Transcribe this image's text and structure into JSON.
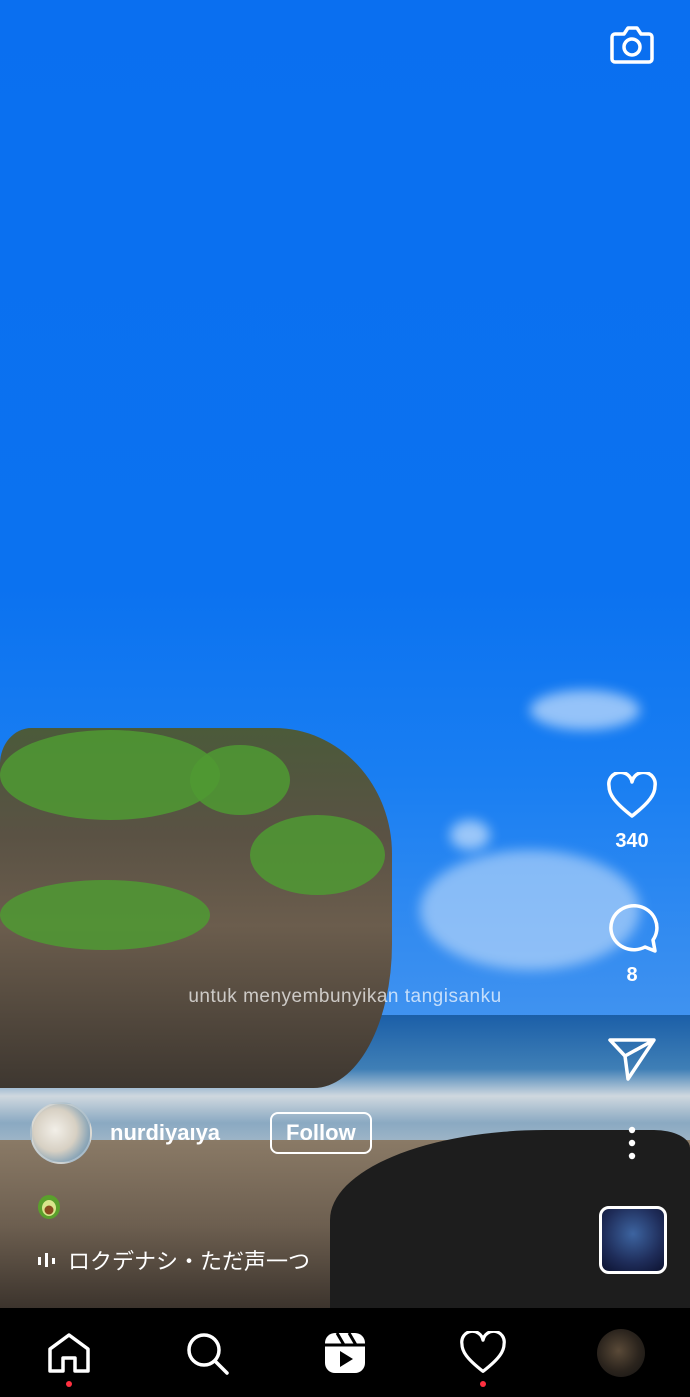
{
  "reel": {
    "caption_overlay": "untuk menyembunyikan tangisanku",
    "author": {
      "username": "nurdiyaıya",
      "follow_label": "Follow"
    },
    "audio": {
      "title": "ロクデナシ・ただ声一つ"
    }
  },
  "actions": {
    "likes": "340",
    "comments": "8"
  },
  "nav": {
    "home_has_notification": true,
    "activity_has_notification": true
  },
  "colors": {
    "sky": "#0b72f0",
    "notification_dot": "#ff3040",
    "nav_bg": "#000000"
  },
  "icons": [
    "camera-icon",
    "heart-icon",
    "comment-icon",
    "share-icon",
    "more-icon",
    "audio-wave-icon",
    "home-icon",
    "search-icon",
    "reels-icon",
    "activity-heart-icon",
    "avocado-emoji-icon"
  ]
}
